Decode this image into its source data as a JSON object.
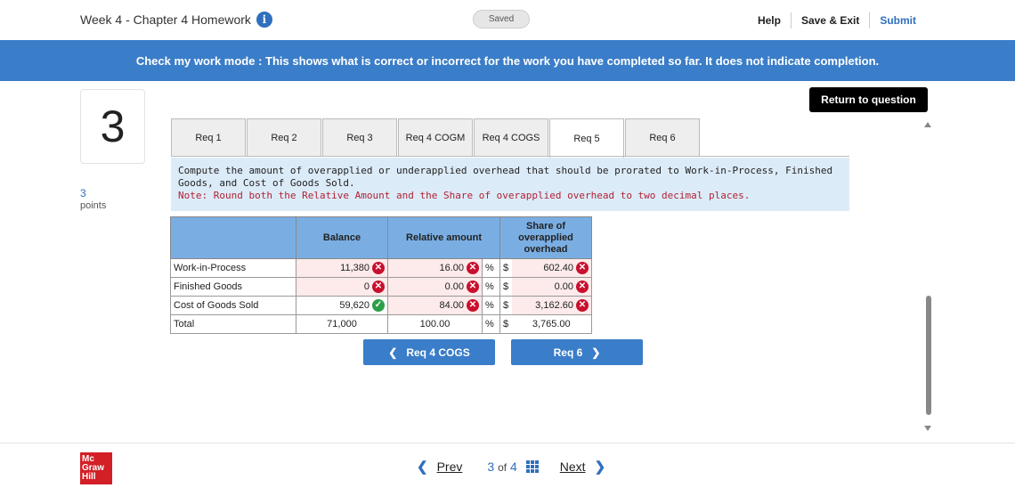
{
  "header": {
    "title": "Week 4 - Chapter 4 Homework",
    "saved": "Saved",
    "help": "Help",
    "save_exit": "Save & Exit",
    "submit": "Submit"
  },
  "banner": "Check my work mode : This shows what is correct or incorrect for the work you have completed so far. It does not indicate completion.",
  "question": {
    "number": "3",
    "points_value": "3",
    "points_label": "points"
  },
  "return_button": "Return to question",
  "tabs": [
    "Req 1",
    "Req 2",
    "Req 3",
    "Req 4 COGM",
    "Req 4 COGS",
    "Req 5",
    "Req 6"
  ],
  "active_tab": "Req 5",
  "instructions": {
    "text": "Compute the amount of overapplied or underapplied overhead that should be prorated to Work-in-Process, Finished Goods, and Cost of Goods Sold.",
    "note": "Note: Round both the Relative Amount and the Share of overapplied overhead to two decimal places."
  },
  "table": {
    "headers": {
      "balance": "Balance",
      "relative": "Relative amount",
      "share": "Share of overapplied overhead"
    },
    "rows": [
      {
        "label": "Work-in-Process",
        "balance": "11,380",
        "relative": "16.00",
        "pct": "%",
        "dollar": "$",
        "share": "602.40"
      },
      {
        "label": "Finished Goods",
        "balance": "0",
        "relative": "0.00",
        "pct": "%",
        "dollar": "$",
        "share": "0.00"
      },
      {
        "label": "Cost of Goods Sold",
        "balance": "59,620",
        "relative": "84.00",
        "pct": "%",
        "dollar": "$",
        "share": "3,162.60"
      },
      {
        "label": "Total",
        "balance": "71,000",
        "relative": "100.00",
        "pct": "%",
        "dollar": "$",
        "share": "3,765.00"
      }
    ]
  },
  "nav": {
    "prev_req": "Req 4 COGS",
    "next_req": "Req 6"
  },
  "footer": {
    "logo": [
      "Mc",
      "Graw",
      "Hill"
    ],
    "prev": "Prev",
    "page_current": "3",
    "page_of": "of",
    "page_total": "4",
    "next": "Next"
  },
  "colors": {
    "accent": "#3a7dc9",
    "error": "#c8102e",
    "correct": "#2e9e47",
    "table_header": "#7aaee3"
  }
}
